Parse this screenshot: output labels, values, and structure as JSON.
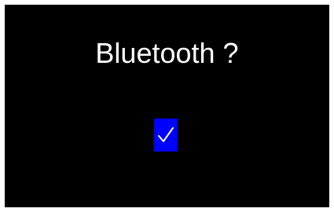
{
  "screen": {
    "question": "Bluetooth ?",
    "background_color": "#000000",
    "text_color": "#ffffff"
  },
  "toggle": {
    "checked": true,
    "icon": "checkmark-icon",
    "fill_color": "#0000ff",
    "check_color": "#ffffff"
  }
}
